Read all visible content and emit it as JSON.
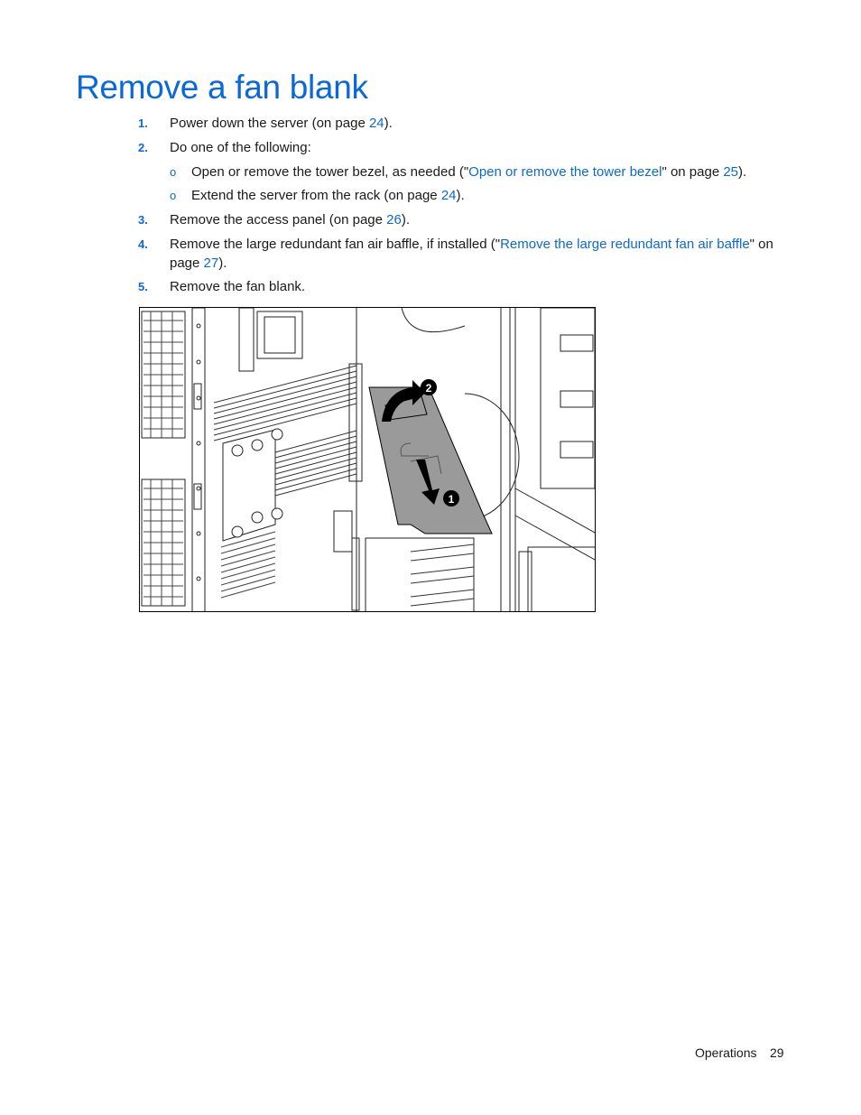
{
  "page": {
    "title": "Remove a fan blank",
    "steps": [
      {
        "number": "1.",
        "pre": "Power down the server (on page ",
        "link": "24",
        "post": ")."
      },
      {
        "number": "2.",
        "text": "Do one of the following:",
        "substeps": [
          {
            "bullet": "o",
            "pre": "Open or remove the tower bezel, as needed (\"",
            "link": "Open or remove the tower bezel",
            "mid": "\" on page ",
            "link2": "25",
            "post": ")."
          },
          {
            "bullet": "o",
            "pre": "Extend the server from the rack (on page ",
            "link": "24",
            "post": ")."
          }
        ]
      },
      {
        "number": "3.",
        "pre": "Remove the access panel (on page ",
        "link": "26",
        "post": ")."
      },
      {
        "number": "4.",
        "pre": "Remove the large redundant fan air baffle, if installed (\"",
        "link": "Remove the large redundant fan air baffle",
        "mid": "\" on page ",
        "link2": "27",
        "post": ")."
      },
      {
        "number": "5.",
        "text": "Remove the fan blank."
      }
    ],
    "figure": {
      "description": "Illustration of server interior showing fan blank removal",
      "callouts": [
        "1",
        "2"
      ]
    },
    "footer": {
      "section": "Operations",
      "page_number": "29"
    }
  },
  "colors": {
    "accent": "#0a68d8",
    "text": "#1a1a1a"
  }
}
